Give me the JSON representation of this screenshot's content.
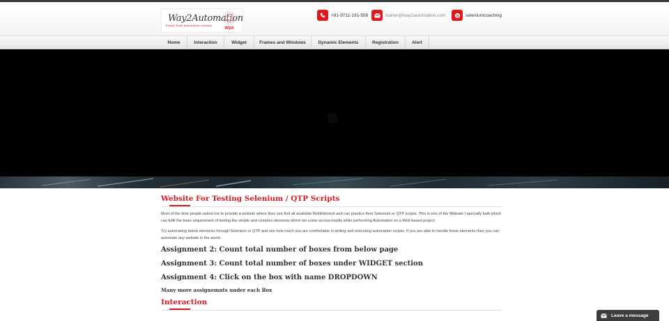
{
  "logo": {
    "name": "Way2Automation",
    "tagline": "Expert level automation courses",
    "mark": "W2A"
  },
  "contacts": [
    {
      "icon": "phone-icon",
      "text": "+91-9711-191-558"
    },
    {
      "icon": "mail-icon",
      "text": "trainer@way2automation.com"
    },
    {
      "icon": "skype-icon",
      "text": "seleniumcoaching"
    }
  ],
  "nav": {
    "items": [
      "Home",
      "Interaction",
      "Widget",
      "Frames and Windows",
      "Dynamic Elements",
      "Registration",
      "Alert"
    ]
  },
  "main": {
    "title": "Website For Testing Selenium / QTP Scripts",
    "paragraph1": "Most of the time people asked me to provide a website where they can find all available WebElement and can practice their Selenium or QTP scripts. This is one of the Website I specially built which can fulfil the basic requirement of testing the simple and complex elements which we come across mostly while performing Automation on a Web based project .",
    "paragraph2": "Try automating below elements through Selenium or QTP and see how much you are comfortable in writing and executing automation scripts. If you are able to handle these elements then you can automate any website in the world.",
    "assignments": [
      "Assignment 2: Count total number of boxes from below page",
      "Assignment 3: Count total number of boxes under WIDGET section",
      "Assignment 4: Click on the box with name DROPDOWN"
    ],
    "more": "Many more assignemnts under each Box",
    "section2_title": "Interaction"
  },
  "chat": {
    "label": "Leave a message",
    "icon": "envelope-icon"
  },
  "colors": {
    "accent": "#e0191e",
    "title_red": "#d71920",
    "banner": "#000000",
    "chat_bg": "#3d3d3d"
  }
}
